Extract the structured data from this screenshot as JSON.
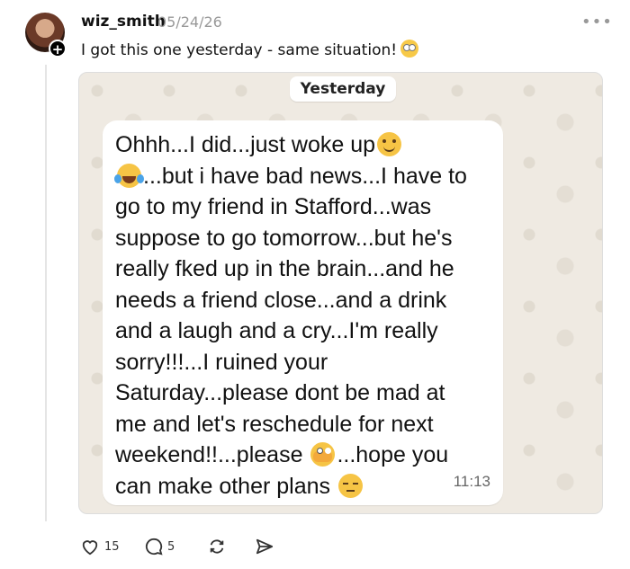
{
  "post": {
    "username": "wiz_smith",
    "date": "05/24/26",
    "more_icon": "more-horizontal-icon",
    "caption": "I got this one yesterday - same situation!",
    "caption_emoji": "face-with-rolling-eyes"
  },
  "chat": {
    "day_label": "Yesterday",
    "message_lines": [
      "Ohhh...I did...just woke up",
      "...but i have bad news...I have to",
      "go to my friend in Stafford...was",
      "suppose to go tomorrow...but he's",
      "really fked up in the brain...and he",
      "needs a friend close...and a drink",
      "and a laugh and a cry...I'm really",
      "sorry!!!...I ruined your",
      "Saturday...please dont be mad at",
      "me and let's reschedule for next",
      "weekend!!...please",
      "...hope you",
      "can make other plans"
    ],
    "time": "11:13"
  },
  "actions": {
    "likes": "15",
    "replies": "5"
  }
}
